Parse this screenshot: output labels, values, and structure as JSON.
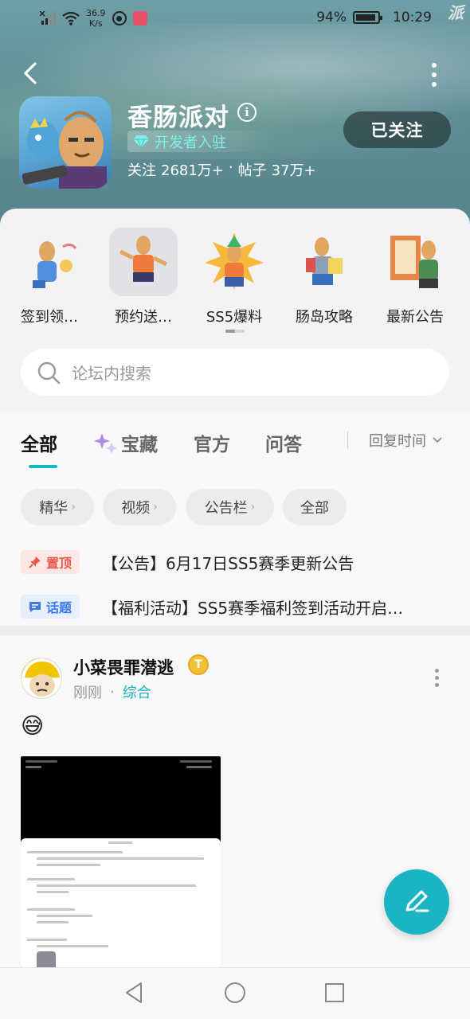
{
  "status_bar": {
    "net_speed": "36.9",
    "net_unit": "K/s",
    "battery": "94%",
    "time": "10:29"
  },
  "header": {
    "game_title": "香肠派对",
    "dev_badge": "开发者入驻",
    "follow_label": "关注",
    "follow_count": "2681万+",
    "separator": "·",
    "posts_label": "帖子",
    "posts_count": "37万+",
    "follow_button": "已关注"
  },
  "quick_links": [
    {
      "label": "签到领…"
    },
    {
      "label": "预约送…"
    },
    {
      "label": "SS5爆料"
    },
    {
      "label": "肠岛攻略"
    },
    {
      "label": "最新公告"
    }
  ],
  "search": {
    "placeholder": "论坛内搜索"
  },
  "tabs": [
    {
      "label": "全部"
    },
    {
      "label": "宝藏"
    },
    {
      "label": "官方"
    },
    {
      "label": "问答"
    }
  ],
  "sort": {
    "label": "回复时间"
  },
  "filters": [
    {
      "label": "精华"
    },
    {
      "label": "视频"
    },
    {
      "label": "公告栏"
    },
    {
      "label": "全部"
    }
  ],
  "notices": [
    {
      "tag": "置顶",
      "text": "【公告】6月17日SS5赛季更新公告"
    },
    {
      "tag": "话题",
      "text": "【福利活动】SS5赛季福利签到活动开启…"
    }
  ],
  "post": {
    "username": "小菜畏罪潜逃",
    "level": "T",
    "time": "刚刚",
    "category": "综合",
    "content_emoji": "😅"
  },
  "colors": {
    "accent": "#14b8c4",
    "pin_tag": "#e8594a",
    "topic_tag": "#3c7be8",
    "dev_badge": "#7ff0e6"
  }
}
